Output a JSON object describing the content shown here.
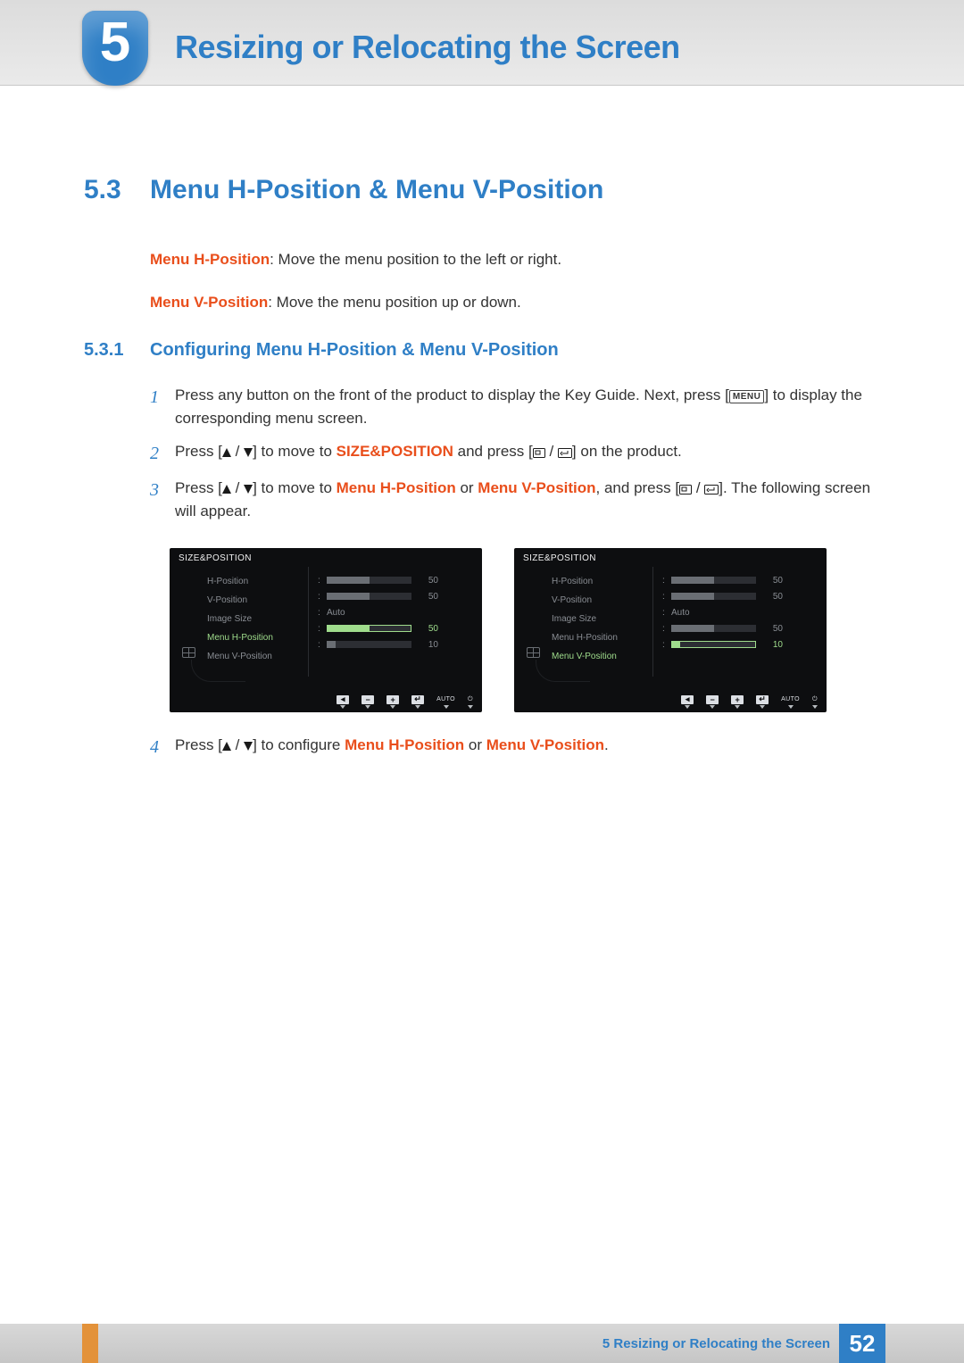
{
  "chapter": {
    "number": "5",
    "title": "Resizing or Relocating the Screen"
  },
  "section": {
    "number": "5.3",
    "title": "Menu H-Position & Menu V-Position"
  },
  "definitions": {
    "h_term": "Menu H-Position",
    "h_desc": ": Move the menu position to the left or right.",
    "v_term": "Menu V-Position",
    "v_desc": ": Move the menu position up or down."
  },
  "subsection": {
    "number": "5.3.1",
    "title": "Configuring Menu H-Position & Menu V-Position"
  },
  "steps": {
    "s1_a": "Press any button on the front of the product to display the Key Guide. Next, press [",
    "s1_menu": "MENU",
    "s1_b": "] to display the corresponding menu screen.",
    "s2_a": "Press [",
    "s2_b": "] to move to ",
    "s2_target": "SIZE&POSITION",
    "s2_c": " and press [",
    "s2_d": "] on the product.",
    "s3_a": "Press [",
    "s3_b": "] to move to ",
    "s3_h": "Menu H-Position",
    "s3_or": " or ",
    "s3_v": "Menu V-Position",
    "s3_c": ", and press [",
    "s3_d": "]. The following screen will appear.",
    "s4_a": "Press [",
    "s4_b": "] to configure ",
    "s4_h": "Menu H-Position",
    "s4_or": " or ",
    "s4_v": "Menu V-Position",
    "s4_c": "."
  },
  "osd": {
    "title": "SIZE&POSITION",
    "items": {
      "hpos": "H-Position",
      "vpos": "V-Position",
      "imgsize": "Image Size",
      "menuh": "Menu H-Position",
      "menuv": "Menu V-Position"
    },
    "values": {
      "hpos": "50",
      "vpos": "50",
      "imgsize": "Auto",
      "menuh": "50",
      "menuv": "10"
    },
    "bottom_auto": "AUTO"
  },
  "footer": {
    "chapter_ref": "5 Resizing or Relocating the Screen",
    "page": "52"
  }
}
